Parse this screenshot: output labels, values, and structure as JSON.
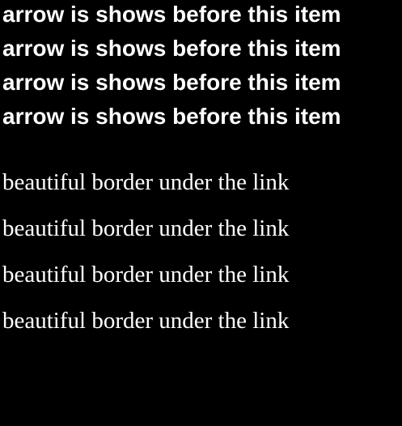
{
  "arrow_items": [
    {
      "label": "arrow is shows before this item"
    },
    {
      "label": "arrow is shows before this item"
    },
    {
      "label": "arrow is shows before this item"
    },
    {
      "label": "arrow is shows before this item"
    }
  ],
  "link_items": [
    {
      "label": "beautiful border under the link"
    },
    {
      "label": "beautiful border under the link"
    },
    {
      "label": "beautiful border under the link"
    },
    {
      "label": "beautiful border under the link"
    }
  ],
  "colors": {
    "background": "#000000",
    "text": "#ffffff"
  }
}
